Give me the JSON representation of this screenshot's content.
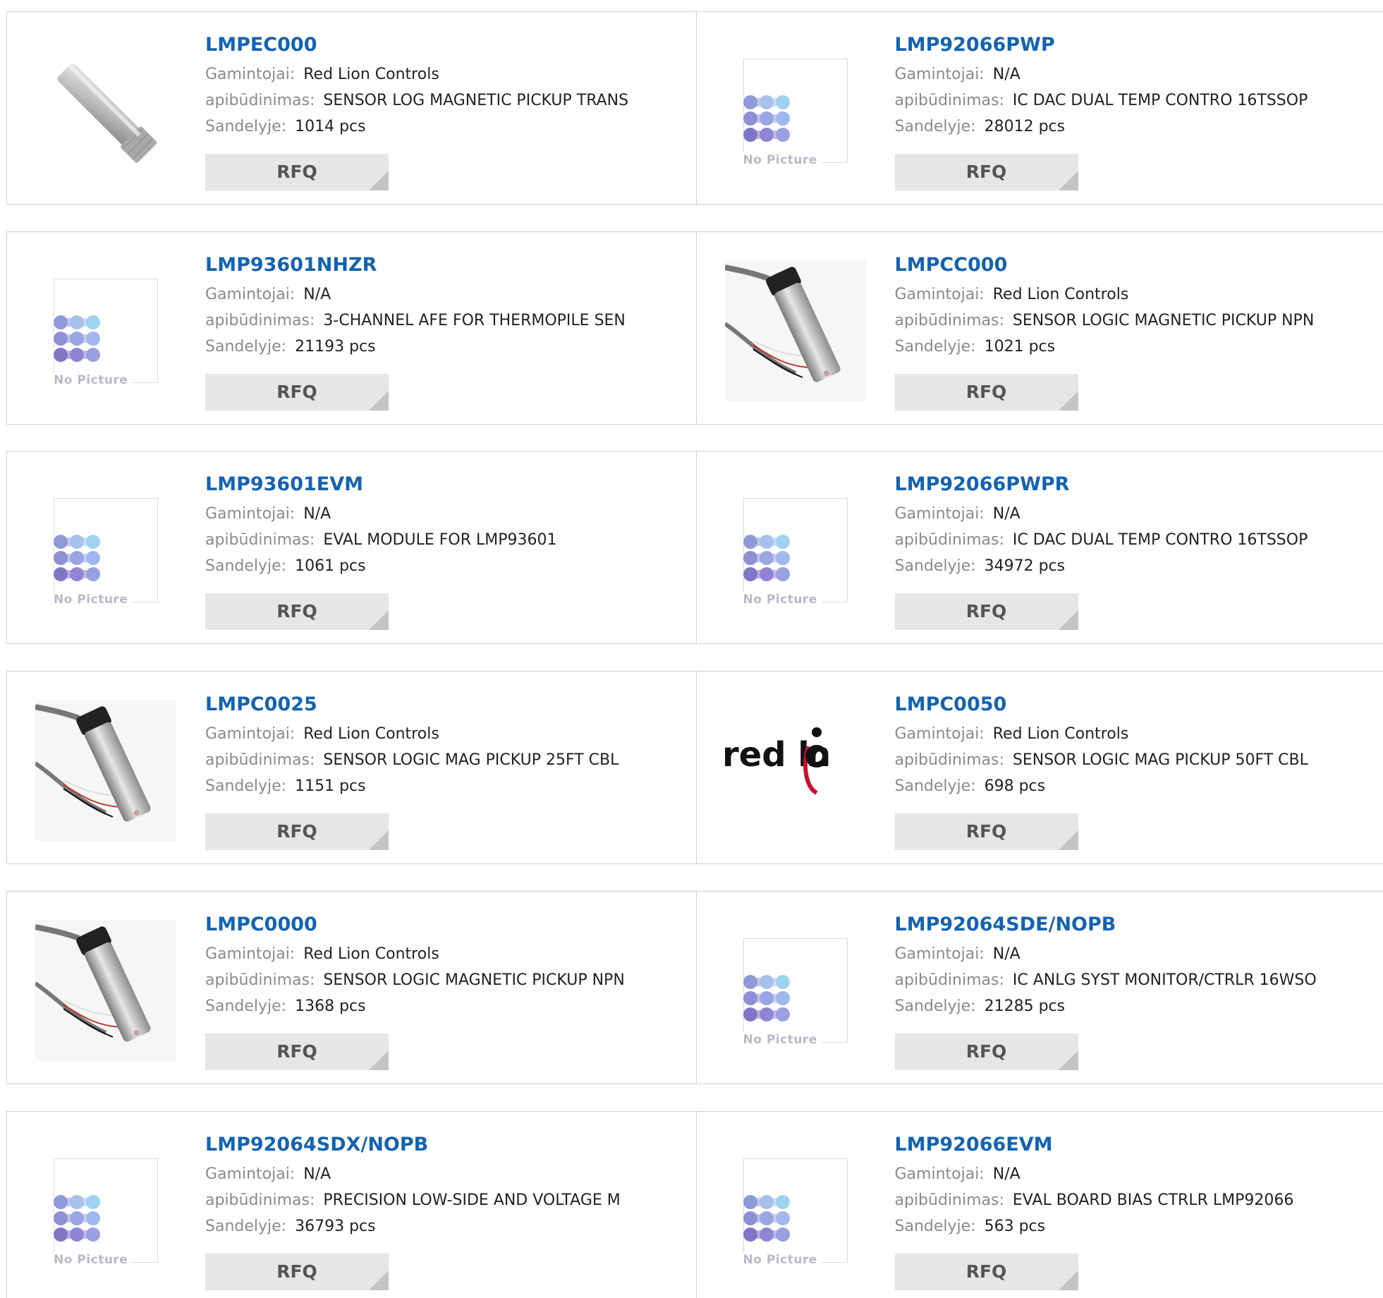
{
  "labels": {
    "manufacturer": "Gamintojai:",
    "description": "apibūdinimas:",
    "stock": "Sandelyje:",
    "rfq": "RFQ",
    "no_picture": "No Picture"
  },
  "colors": {
    "title": "#1463b0",
    "rfq_bg": "#e6e6e6",
    "border": "#cfcfcf"
  },
  "products": [
    {
      "part": "LMPEC000",
      "manufacturer": "Red Lion Controls",
      "description": "SENSOR LOG MAGNETIC PICKUP TRANS",
      "stock": "1014 pcs",
      "image": "sensor-plain-photo"
    },
    {
      "part": "LMP92066PWP",
      "manufacturer": "N/A",
      "description": "IC DAC DUAL TEMP CONTRO 16TSSOP",
      "stock": "28012 pcs",
      "image": "no-picture"
    },
    {
      "part": "LMP93601NHZR",
      "manufacturer": "N/A",
      "description": "3-CHANNEL AFE FOR THERMOPILE SEN",
      "stock": "21193 pcs",
      "image": "no-picture"
    },
    {
      "part": "LMPCC000",
      "manufacturer": "Red Lion Controls",
      "description": "SENSOR LOGIC MAGNETIC PICKUP NPN",
      "stock": "1021 pcs",
      "image": "sensor-cable-photo"
    },
    {
      "part": "LMP93601EVM",
      "manufacturer": "N/A",
      "description": "EVAL MODULE FOR LMP93601",
      "stock": "1061 pcs",
      "image": "no-picture"
    },
    {
      "part": "LMP92066PWPR",
      "manufacturer": "N/A",
      "description": "IC DAC DUAL TEMP CONTRO 16TSSOP",
      "stock": "34972 pcs",
      "image": "no-picture"
    },
    {
      "part": "LMPC0025",
      "manufacturer": "Red Lion Controls",
      "description": "SENSOR LOGIC MAG PICKUP 25FT CBL",
      "stock": "1151 pcs",
      "image": "sensor-cable-photo"
    },
    {
      "part": "LMPC0050",
      "manufacturer": "Red Lion Controls",
      "description": "SENSOR LOGIC MAG PICKUP 50FT CBL",
      "stock": "698 pcs",
      "image": "red-lion-logo"
    },
    {
      "part": "LMPC0000",
      "manufacturer": "Red Lion Controls",
      "description": "SENSOR LOGIC MAGNETIC PICKUP NPN",
      "stock": "1368 pcs",
      "image": "sensor-cable-photo"
    },
    {
      "part": "LMP92064SDE/NOPB",
      "manufacturer": "N/A",
      "description": "IC ANLG SYST MONITOR/CTRLR 16WSO",
      "stock": "21285 pcs",
      "image": "no-picture"
    },
    {
      "part": "LMP92064SDX/NOPB",
      "manufacturer": "N/A",
      "description": "PRECISION LOW-SIDE AND VOLTAGE M",
      "stock": "36793 pcs",
      "image": "no-picture"
    },
    {
      "part": "LMP92066EVM",
      "manufacturer": "N/A",
      "description": "EVAL BOARD BIAS CTRLR LMP92066",
      "stock": "563 pcs",
      "image": "no-picture"
    }
  ]
}
